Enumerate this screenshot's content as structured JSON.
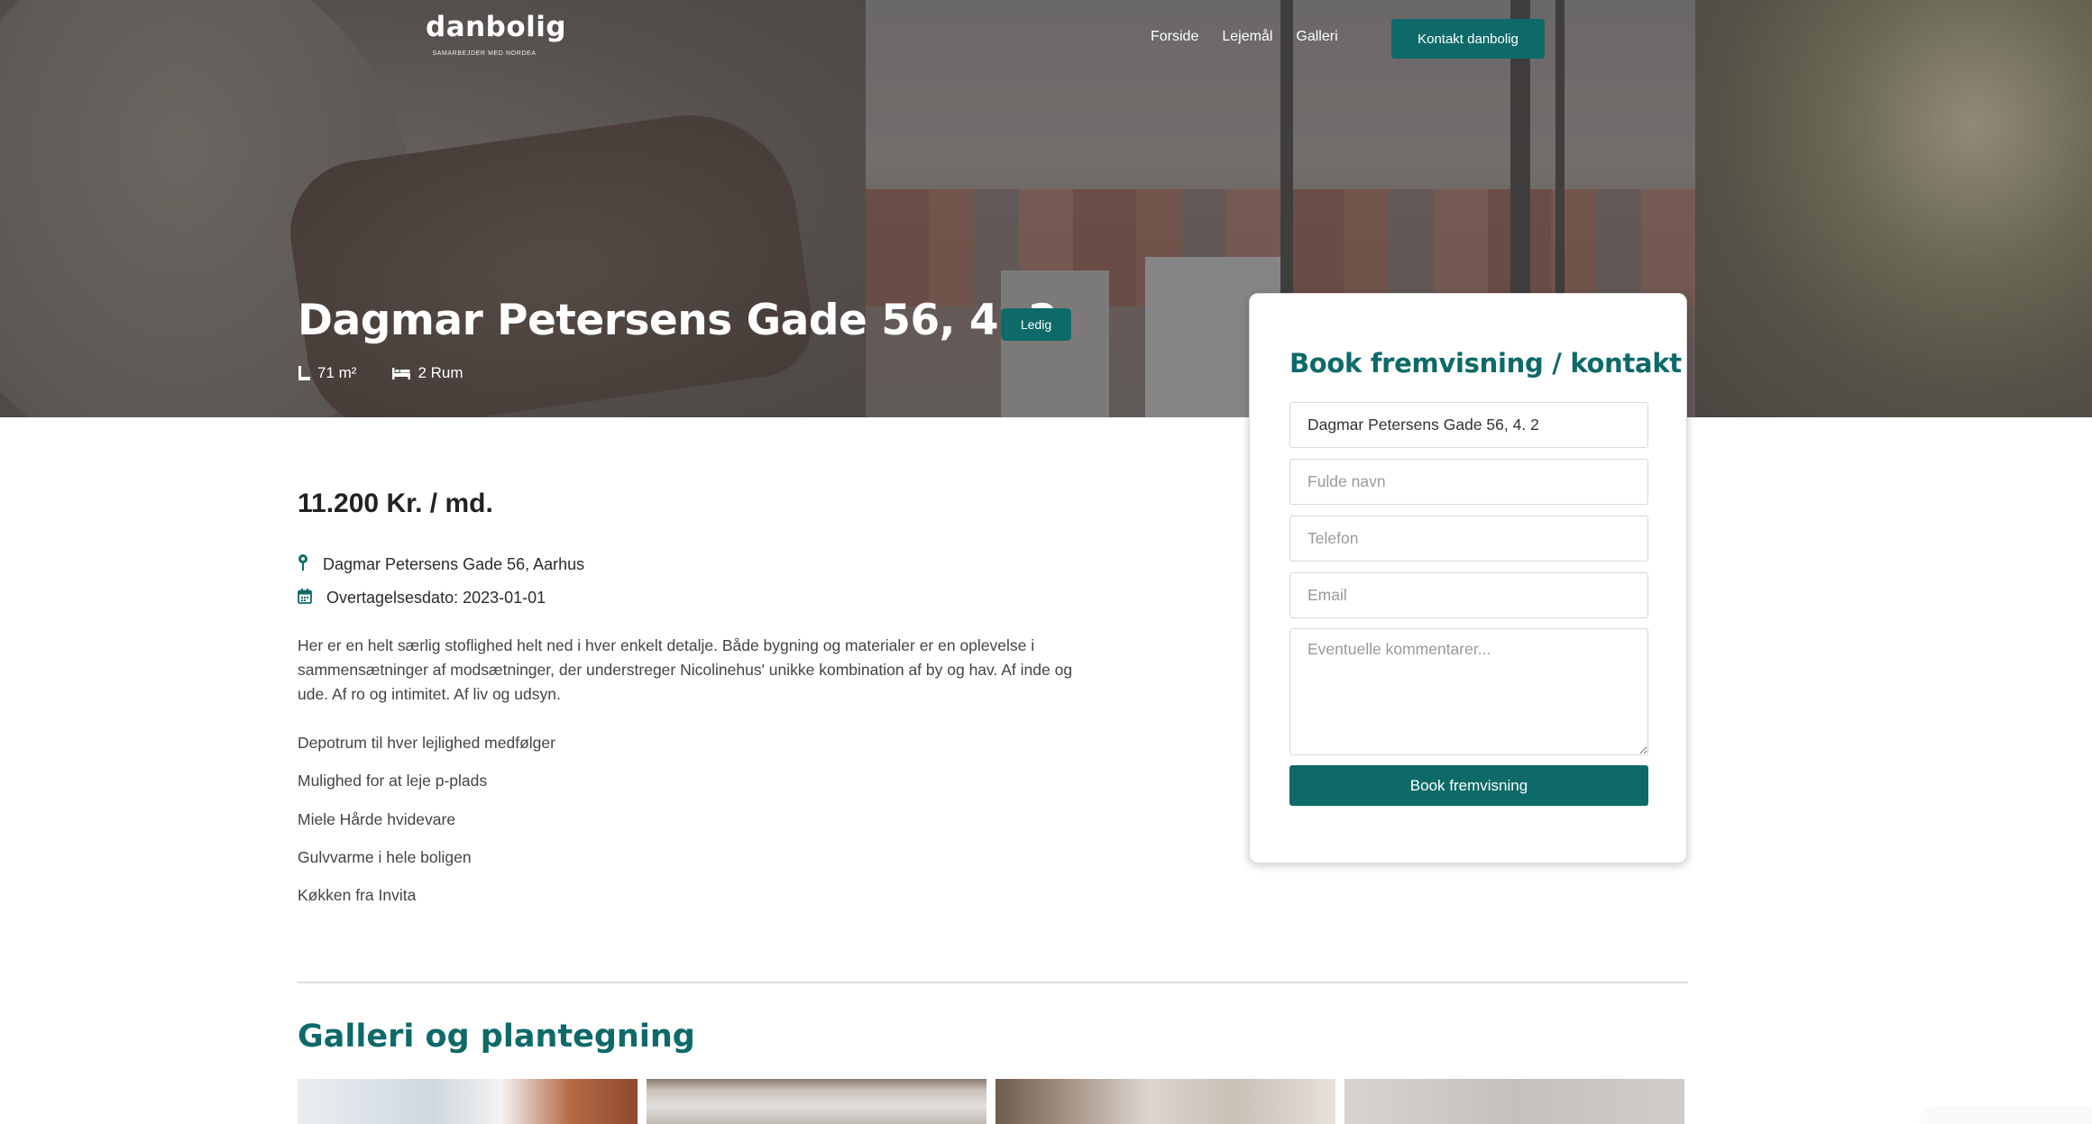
{
  "brand": {
    "name": "danbolig",
    "tagline": "SAMARBEJDER MED NORDEA"
  },
  "nav": {
    "items": [
      "Forside",
      "Lejemål",
      "Galleri"
    ],
    "cta": "Kontakt danbolig"
  },
  "listing": {
    "title": "Dagmar Petersens Gade 56, 4. 2",
    "status": "Ledig",
    "area": "71 m²",
    "rooms": "2 Rum",
    "price": "11.200 Kr. / md.",
    "address": "Dagmar Petersens Gade 56, Aarhus",
    "takeover": "Overtagelsesdato: 2023-01-01",
    "description": "Her er en helt særlig stoflighed helt ned i hver enkelt detalje. Både bygning og materialer er en oplevelse i sammensætninger af modsætninger, der understreger Nicolinehus' unikke kombination af by og hav. Af inde og ude. Af ro og intimitet. Af liv og udsyn.",
    "features": [
      "Depotrum til hver lejlighed medfølger",
      "Mulighed for at leje p-plads",
      "Miele Hårde hvidevare",
      "Gulvvarme i hele boligen",
      "Køkken fra Invita"
    ]
  },
  "form": {
    "title": "Book fremvisning / kontakt",
    "property_value": "Dagmar Petersens Gade 56, 4. 2",
    "name_placeholder": "Fulde navn",
    "phone_placeholder": "Telefon",
    "email_placeholder": "Email",
    "comment_placeholder": "Eventuelle kommentarer...",
    "submit": "Book fremvisning"
  },
  "gallery": {
    "title": "Galleri og plantegning"
  },
  "icons": {
    "area": "ruler-corner-icon",
    "rooms": "bed-icon",
    "address": "map-pin-icon",
    "takeover": "calendar-icon"
  },
  "colors": {
    "accent": "#0d6a69",
    "text": "#2b2b2b"
  }
}
